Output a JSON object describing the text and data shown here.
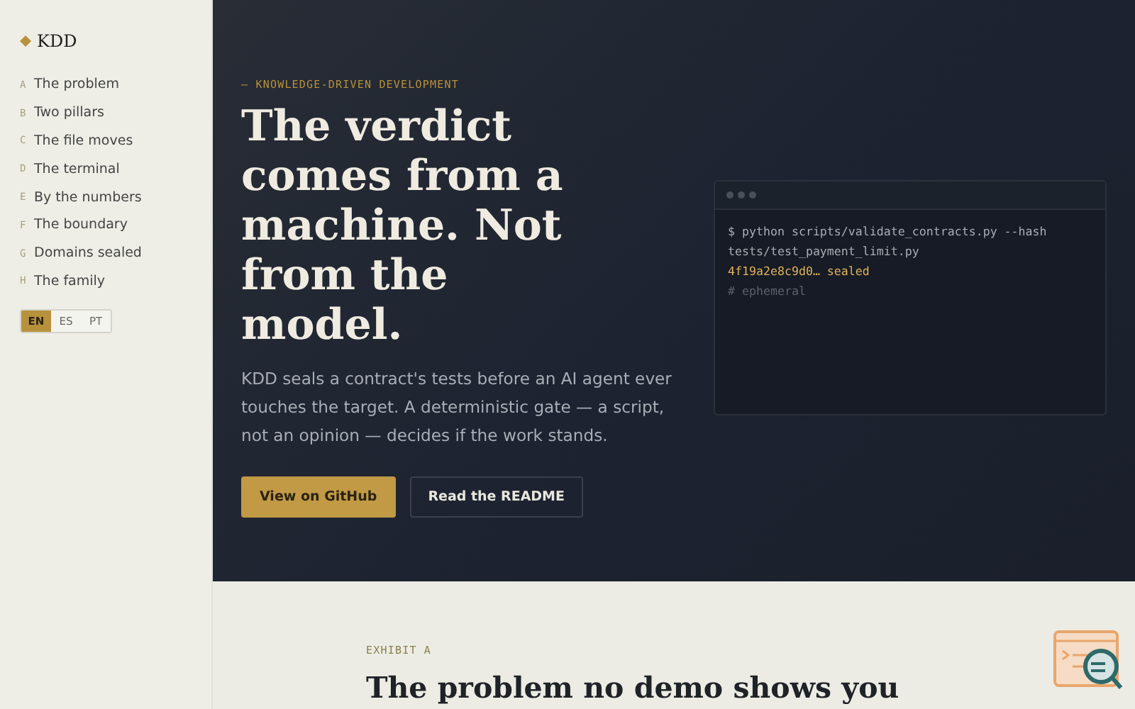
{
  "brand": {
    "name": "KDD"
  },
  "nav": [
    {
      "letter": "A",
      "label": "The problem"
    },
    {
      "letter": "B",
      "label": "Two pillars"
    },
    {
      "letter": "C",
      "label": "The file moves"
    },
    {
      "letter": "D",
      "label": "The terminal"
    },
    {
      "letter": "E",
      "label": "By the numbers"
    },
    {
      "letter": "F",
      "label": "The boundary"
    },
    {
      "letter": "G",
      "label": "Domains sealed"
    },
    {
      "letter": "H",
      "label": "The family"
    }
  ],
  "languages": [
    {
      "label": "EN",
      "selected": true
    },
    {
      "label": "ES",
      "selected": false
    },
    {
      "label": "PT",
      "selected": false
    }
  ],
  "hero": {
    "eyebrow": "— KNOWLEDGE-DRIVEN DEVELOPMENT",
    "title": "The verdict comes from a machine. Not from the model.",
    "body": "KDD seals a contract's tests before an AI agent ever touches the target. A deterministic gate — a script, not an opinion — decides if the work stands.",
    "buttons": [
      {
        "label": "View on GitHub",
        "kind": "primary"
      },
      {
        "label": "Read the README",
        "kind": "secondary"
      }
    ]
  },
  "terminal": {
    "lines": [
      {
        "kind": "command",
        "text": "$ python scripts/validate_contracts.py --hash"
      },
      {
        "kind": "command",
        "text": "tests/test_payment_limit.py"
      },
      {
        "kind": "output",
        "text": "4f19a2e8c9d0… sealed"
      },
      {
        "kind": "comment",
        "text": "# ephemeral"
      }
    ]
  },
  "section": {
    "eyebrow": "EXHIBIT A",
    "title": "The problem no demo shows you"
  }
}
